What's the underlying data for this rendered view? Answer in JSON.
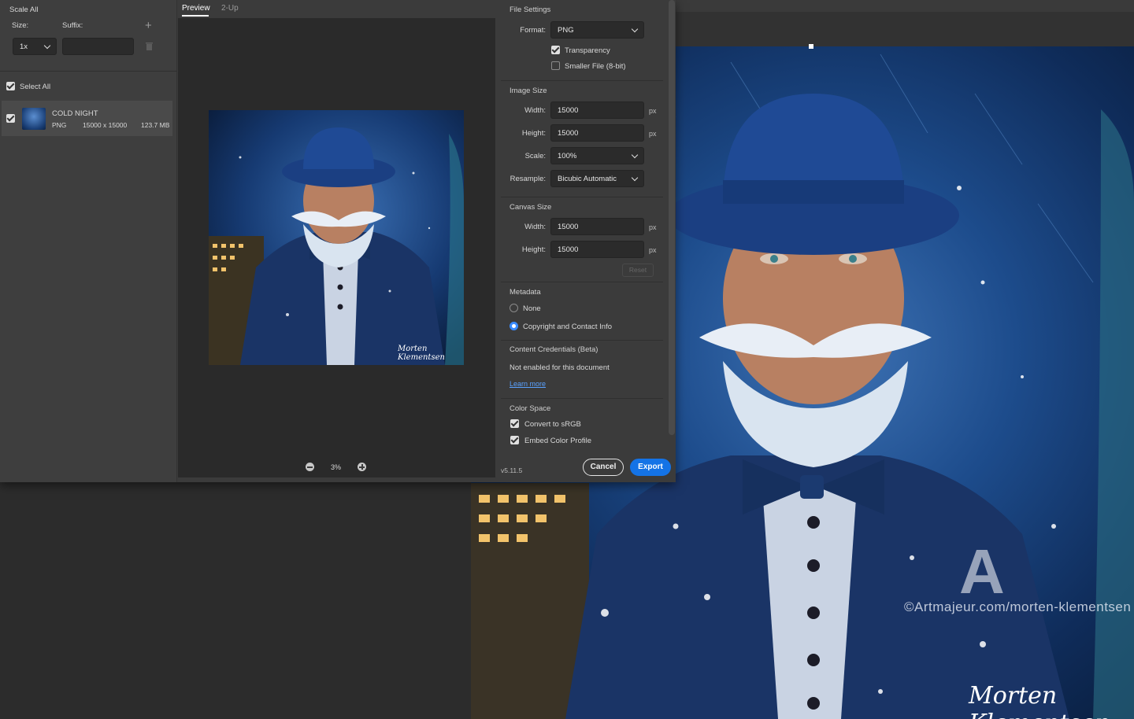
{
  "left_panel": {
    "scale_all_label": "Scale All",
    "size_label": "Size:",
    "suffix_label": "Suffix:",
    "size_value": "1x",
    "suffix_value": "",
    "select_all_label": "Select All",
    "file": {
      "name": "COLD NIGHT",
      "format": "PNG",
      "dimensions": "15000 x 15000",
      "filesize": "123.7 MB"
    }
  },
  "tabs": {
    "preview": "Preview",
    "two_up": "2-Up"
  },
  "zoom": {
    "value": "3%"
  },
  "right_panel": {
    "file_settings": {
      "title": "File Settings",
      "format_label": "Format:",
      "format_value": "PNG",
      "transparency_label": "Transparency",
      "smaller_file_label": "Smaller File (8-bit)"
    },
    "image_size": {
      "title": "Image Size",
      "width_label": "Width:",
      "width_value": "15000",
      "height_label": "Height:",
      "height_value": "15000",
      "scale_label": "Scale:",
      "scale_value": "100%",
      "resample_label": "Resample:",
      "resample_value": "Bicubic Automatic",
      "unit": "px"
    },
    "canvas_size": {
      "title": "Canvas Size",
      "width_label": "Width:",
      "width_value": "15000",
      "height_label": "Height:",
      "height_value": "15000",
      "unit": "px",
      "reset_label": "Reset"
    },
    "metadata": {
      "title": "Metadata",
      "none_label": "None",
      "copyright_label": "Copyright and Contact Info"
    },
    "content_credentials": {
      "title": "Content Credentials (Beta)",
      "status": "Not enabled for this document",
      "learn_more": "Learn more"
    },
    "color_space": {
      "title": "Color Space",
      "convert_label": "Convert to sRGB",
      "embed_label": "Embed Color Profile"
    }
  },
  "footer": {
    "version": "v5.11.5",
    "cancel_label": "Cancel",
    "export_label": "Export"
  },
  "artwork": {
    "watermark": "©Artmajeur.com/morten-klementsen",
    "signature": "Morten Klementsen",
    "thumb_signature": "Morten Klementsen"
  },
  "colors": {
    "accent": "#1473e6",
    "radio_on": "#3a8bff",
    "link": "#5aa2ff"
  }
}
